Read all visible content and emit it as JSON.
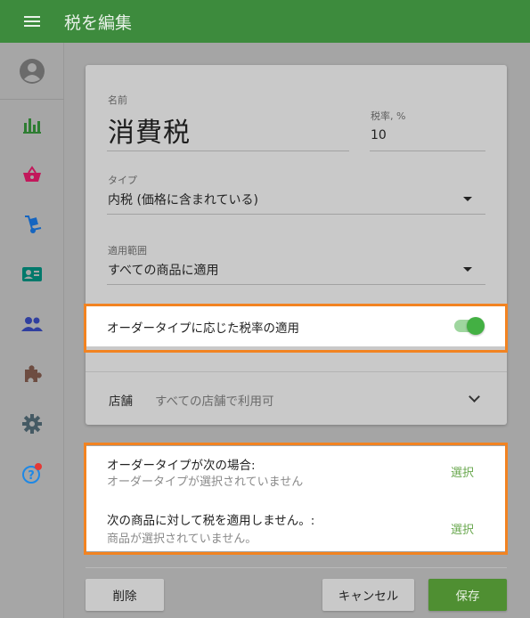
{
  "header": {
    "title": "税を編集"
  },
  "sidebar": {
    "colors": {
      "reports": "#2e7d32",
      "items": "#c2185b",
      "inventory": "#1565c0",
      "customers": "#00796b",
      "employees": "#303f9f",
      "integrations": "#6d4c41",
      "settings": "#455a64",
      "help": "#1e88e5",
      "notification_dot": "#e53935"
    }
  },
  "form": {
    "name_label": "名前",
    "name_value": "消費税",
    "rate_label": "税率, %",
    "rate_value": "10",
    "type_label": "タイプ",
    "type_value": "内税 (価格に含まれている)",
    "scope_label": "適用範囲",
    "scope_value": "すべての商品に適用",
    "order_type_toggle_label": "オーダータイプに応じた税率の適用",
    "order_type_toggle_on": true,
    "store_label": "店舗",
    "store_value": "すべての店舗で利用可"
  },
  "conditions": {
    "order_type_title": "オーダータイプが次の場合:",
    "order_type_sub": "オーダータイプが選択されていません",
    "order_type_action": "選択",
    "items_title": "次の商品に対して税を適用しません。:",
    "items_sub": "商品が選択されていません。",
    "items_action": "選択"
  },
  "buttons": {
    "delete": "削除",
    "cancel": "キャンセル",
    "save": "保存"
  },
  "colors": {
    "header": "#3d8b3d",
    "accent": "#43b043",
    "highlight": "#f28321",
    "save_button": "#4f8f32",
    "link": "#6aa84f"
  }
}
